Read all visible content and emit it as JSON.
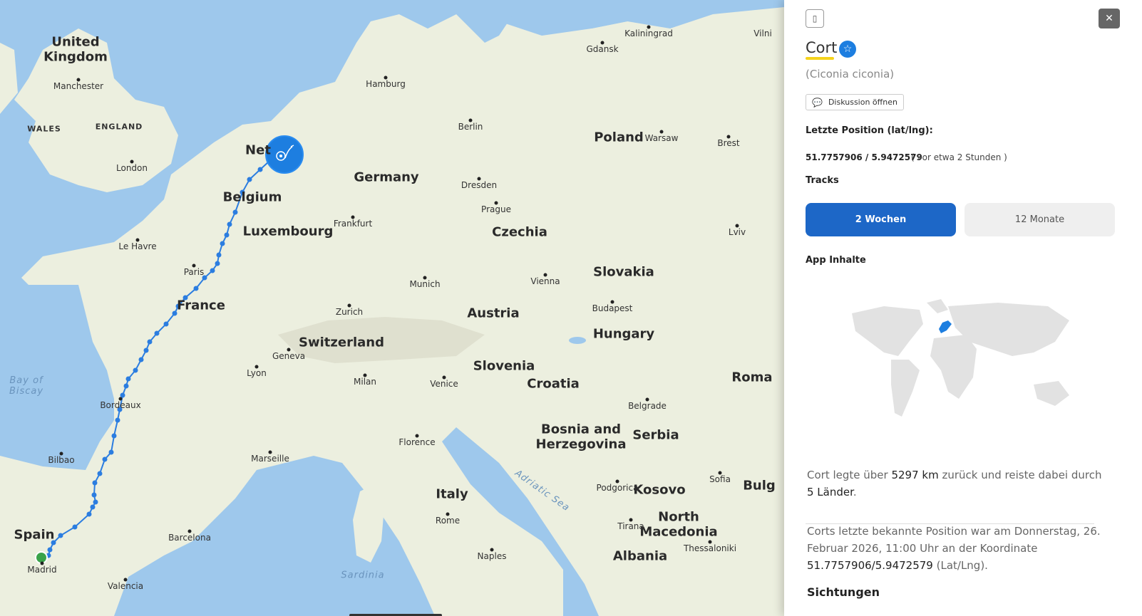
{
  "map": {
    "countries": [
      "United Kingdom",
      "Germany",
      "Poland",
      "France",
      "Belgium",
      "Luxembourg",
      "Czechia",
      "Slovakia",
      "Austria",
      "Hungary",
      "Switzerland",
      "Slovenia",
      "Croatia",
      "Bosnia and Herzegovina",
      "Serbia",
      "Italy",
      "Spain",
      "Kosovo",
      "North Macedonia",
      "Albania",
      "Roma",
      "Bulg",
      "Net"
    ],
    "cities": [
      "Manchester",
      "London",
      "Le Havre",
      "Paris",
      "Hamburg",
      "Gdansk",
      "Kaliningrad",
      "Berlin",
      "Warsaw",
      "Brest",
      "Dresden",
      "Prague",
      "Frankfurt",
      "Munich",
      "Vienna",
      "Budapest",
      "Zurich",
      "Geneva",
      "Lyon",
      "Milan",
      "Venice",
      "Bordeaux",
      "Bilbao",
      "Marseille",
      "Florence",
      "Belgrade",
      "Lviv",
      "Barcelona",
      "Madrid",
      "Valencia",
      "Rome",
      "Naples",
      "Podgorica",
      "Tirana",
      "Sofia",
      "Thessaloniki",
      "Vilni"
    ],
    "regions": [
      "WALES",
      "ENGLAND"
    ],
    "waters": [
      "Bay of Biscay",
      "Adriatic Sea",
      "Sardinia"
    ],
    "track_color": "#2b7de0",
    "current_marker_color": "#1d7ee0",
    "start_marker_color": "#3aa34a"
  },
  "panel": {
    "title": "Cort",
    "species": "(Ciconia ciconia)",
    "discuss_label": "Diskussion öffnen",
    "last_position_label": "Letzte Position (lat/lng):",
    "last_position_value": "51.7757906 / 5.9472579",
    "last_position_ago": "( vor etwa 2 Stunden )",
    "tracks_label": "Tracks",
    "track_btn_2w": "2 Wochen",
    "track_btn_12m": "12 Monate",
    "app_content_label": "App Inhalte",
    "summary_1a": "Cort legte über ",
    "summary_1_km": "5297 km",
    "summary_1b": " zurück und reiste dabei durch ",
    "summary_1_countries": "5 Länder",
    "summary_1c": ".",
    "summary_2a": "Corts letzte bekannte Position war am Donnerstag, 26. Februar 2026, 11:00 Uhr an der Koordinate ",
    "summary_2_coords": "51.7757906/5.9472579",
    "summary_2b": " (Lat/Lng).",
    "sightings_label": "Sichtungen",
    "accent_color": "#1d67c7"
  }
}
